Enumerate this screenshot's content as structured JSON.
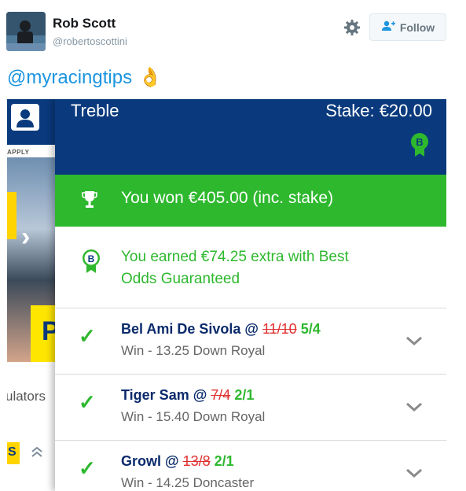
{
  "tweet": {
    "display_name": "Rob Scott",
    "handle": "@robertoscottini",
    "follow_label": "Follow",
    "text": "@myracingtips",
    "emoji": "👌"
  },
  "background_app": {
    "apply_label": "APPLY",
    "p_letter": "P",
    "accumulators_text": "ulators",
    "s_chip": "S"
  },
  "bet_card": {
    "bet_type": "Treble",
    "stake": "Stake: €20.00",
    "won_text": "You won €405.00 (inc. stake)",
    "bog_text": "You earned €74.25 extra with Best Odds Guaranteed",
    "badge_letter": "B",
    "selections": [
      {
        "name": "Bel Ami De Sivola @ ",
        "old_odds": "11/10",
        "new_odds": "5/4",
        "result": "Win - 13.25 Down Royal"
      },
      {
        "name": "Tiger Sam @ ",
        "old_odds": "7/4",
        "new_odds": "2/1",
        "result": "Win - 15.40 Down Royal"
      },
      {
        "name": "Growl @ ",
        "old_odds": "13/8",
        "new_odds": "2/1",
        "result": "Win - 14.25 Doncaster"
      }
    ]
  },
  "colors": {
    "brand_blue": "#0a3a7d",
    "win_green": "#2eb82e",
    "strike_red": "#e03030",
    "link_blue": "#1b95e0"
  }
}
